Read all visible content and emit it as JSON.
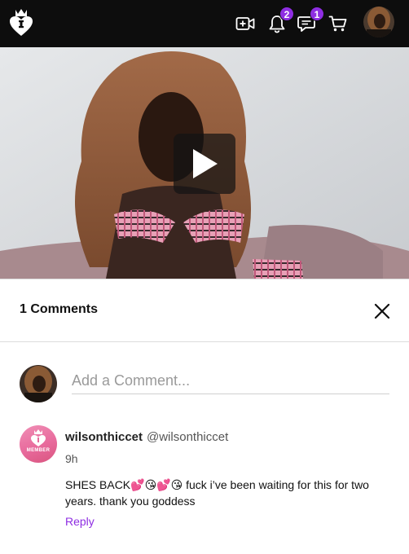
{
  "topbar": {
    "background": "#0d0d0d",
    "logo_icon": "crown-heart-logo",
    "icons": [
      "add-video-icon",
      "bell-icon",
      "chat-icon",
      "cart-icon"
    ],
    "notifications_badge": "2",
    "messages_badge": "1",
    "badge_color": "#8e2de2"
  },
  "video": {
    "play_icon": "play-icon"
  },
  "comments": {
    "title": "1 Comments",
    "close_icon": "close-icon",
    "input_placeholder": "Add a Comment...",
    "items": [
      {
        "badge_text": "MEMBER",
        "username": "wilsonthiccet",
        "handle": "@wilsonthiccet",
        "time": "9h",
        "text": "SHES BACK💕😘💕😘 fuck i’ve been waiting for this for two years. thank you goddess",
        "reply_label": "Reply"
      }
    ]
  },
  "colors": {
    "accent": "#8e2de2",
    "member_badge": "#e86a9c"
  }
}
